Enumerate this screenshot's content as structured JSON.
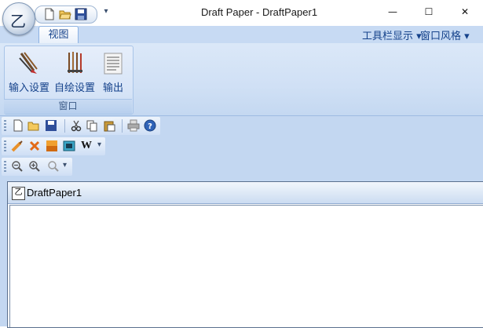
{
  "window": {
    "title": "Draft Paper - DraftPaper1",
    "minimize_glyph": "—",
    "maximize_glyph": "☐",
    "close_glyph": "✕"
  },
  "app_button": {
    "glyph": "乙"
  },
  "quick_access": {
    "items": [
      "new-doc-icon",
      "open-folder-icon",
      "save-icon"
    ],
    "dropdown_glyph": "▾"
  },
  "ribbon": {
    "tabs": [
      {
        "label": "视图"
      }
    ],
    "right_menus": [
      {
        "label": "工具栏显示 ▾"
      },
      {
        "label": "窗口风格 ▾"
      }
    ],
    "group": {
      "caption": "窗口",
      "buttons": [
        {
          "label": "输入设置",
          "icon": "input-settings-icon"
        },
        {
          "label": "自绘设置",
          "icon": "draw-settings-icon"
        },
        {
          "label": "输出",
          "icon": "output-icon"
        }
      ]
    }
  },
  "toolbars": {
    "standard": [
      "new-icon",
      "open-icon",
      "save-icon",
      "cut-icon",
      "copy-icon",
      "paste-icon",
      "print-icon",
      "help-icon"
    ],
    "drawing": {
      "items": [
        "brush-icon",
        "erase-icon",
        "fill-icon",
        "frame-icon"
      ],
      "font_label": "W",
      "dropdown_glyph": "▾"
    },
    "zoom": {
      "items": [
        "zoom-out-icon",
        "zoom-in-icon",
        "zoom-fit-icon"
      ],
      "dropdown_glyph": "▾"
    }
  },
  "document": {
    "tab_title": "DraftPaper1",
    "icon_glyph": "乙"
  },
  "colors": {
    "ribbon_bg": "#d0e0f5",
    "accent_text": "#15428b",
    "toolbar_bg": "#c3d7f1"
  }
}
